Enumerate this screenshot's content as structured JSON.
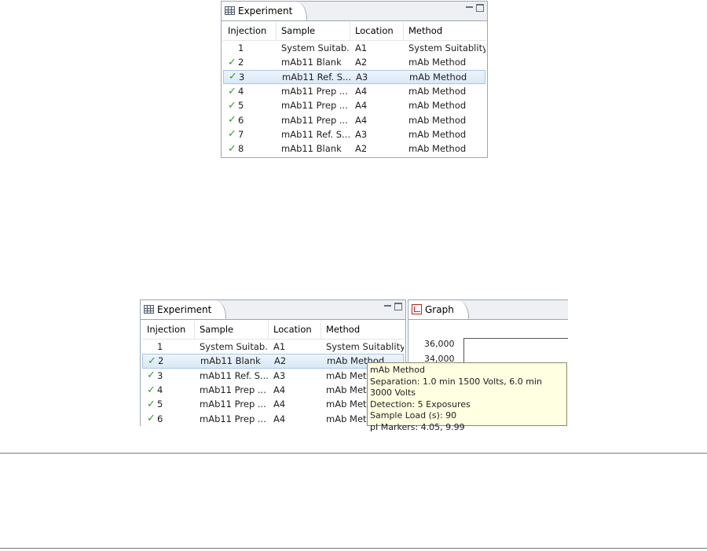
{
  "top_view": {
    "tab_label": "Experiment",
    "columns": [
      "Injection",
      "Sample",
      "Location",
      "Method"
    ],
    "rows": [
      {
        "check": false,
        "injection": "1",
        "sample": "System Suitab...",
        "location": "A1",
        "method": "System Suitablity"
      },
      {
        "check": true,
        "injection": "2",
        "sample": "mAb11 Blank",
        "location": "A2",
        "method": "mAb Method"
      },
      {
        "check": true,
        "injection": "3",
        "sample": "mAb11 Ref. S...",
        "location": "A3",
        "method": "mAb Method",
        "selected": true
      },
      {
        "check": true,
        "injection": "4",
        "sample": "mAb11 Prep ...",
        "location": "A4",
        "method": "mAb Method"
      },
      {
        "check": true,
        "injection": "5",
        "sample": "mAb11 Prep ...",
        "location": "A4",
        "method": "mAb Method"
      },
      {
        "check": true,
        "injection": "6",
        "sample": "mAb11 Prep ...",
        "location": "A4",
        "method": "mAb Method"
      },
      {
        "check": true,
        "injection": "7",
        "sample": "mAb11 Ref. S...",
        "location": "A3",
        "method": "mAb Method"
      },
      {
        "check": true,
        "injection": "8",
        "sample": "mAb11 Blank",
        "location": "A2",
        "method": "mAb Method"
      }
    ]
  },
  "bottom_view": {
    "tab_label": "Experiment",
    "columns": [
      "Injection",
      "Sample",
      "Location",
      "Method"
    ],
    "rows": [
      {
        "check": false,
        "injection": "1",
        "sample": "System Suitab...",
        "location": "A1",
        "method": "System Suitablity"
      },
      {
        "check": true,
        "injection": "2",
        "sample": "mAb11 Blank",
        "location": "A2",
        "method": "mAb Method",
        "hover": true
      },
      {
        "check": true,
        "injection": "3",
        "sample": "mAb11 Ref. S...",
        "location": "A3",
        "method": "mAb Meth"
      },
      {
        "check": true,
        "injection": "4",
        "sample": "mAb11 Prep ...",
        "location": "A4",
        "method": "mAb Meth"
      },
      {
        "check": true,
        "injection": "5",
        "sample": "mAb11 Prep ...",
        "location": "A4",
        "method": "mAb Meth"
      },
      {
        "check": true,
        "injection": "6",
        "sample": "mAb11 Prep ...",
        "location": "A4",
        "method": "mAb Meth"
      }
    ]
  },
  "graph_view": {
    "tab_label": "Graph",
    "y_ticks": [
      "36,000",
      "34,000"
    ]
  },
  "tooltip": {
    "lines": [
      "mAb Method",
      "Separation: 1.0 min 1500 Volts, 6.0 min 3000 Volts",
      "Detection: 5 Exposures",
      "Sample Load (s): 90",
      "pI Markers: 4.05, 9.99"
    ]
  },
  "icons": {
    "check": "checkmark-icon",
    "view": "grid-view-icon",
    "graph": "graph-icon"
  },
  "colors": {
    "selection": "#d9e8f7",
    "check": "#2e9b3a",
    "tooltip_bg": "#ffffe1",
    "border": "#9aa6b6"
  }
}
